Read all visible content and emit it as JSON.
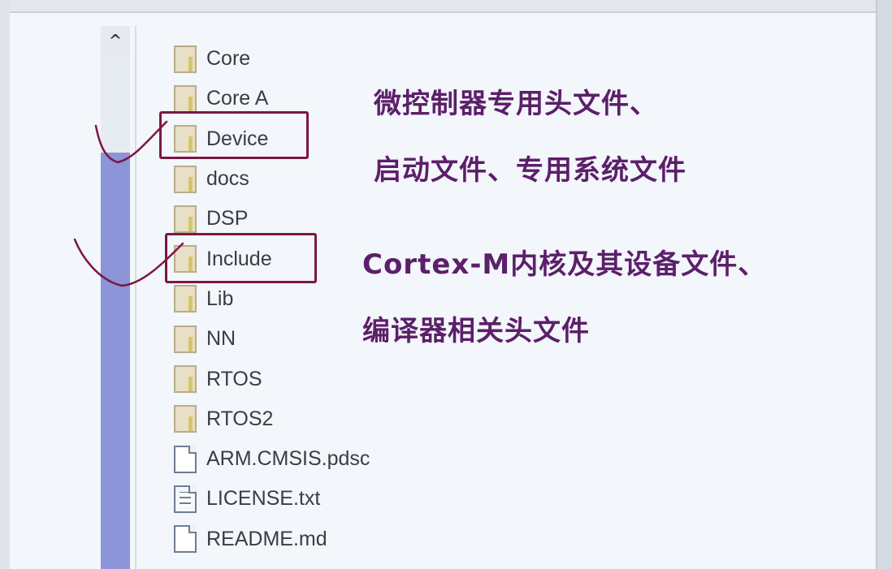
{
  "scrollbar": {
    "up_glyph": "^"
  },
  "files": [
    {
      "name": "Core",
      "type": "folder"
    },
    {
      "name": "Core A",
      "type": "folder"
    },
    {
      "name": "Device",
      "type": "folder",
      "highlighted": true
    },
    {
      "name": "docs",
      "type": "folder"
    },
    {
      "name": "DSP",
      "type": "folder"
    },
    {
      "name": "Include",
      "type": "folder",
      "highlighted": true
    },
    {
      "name": "Lib",
      "type": "folder"
    },
    {
      "name": "NN",
      "type": "folder"
    },
    {
      "name": "RTOS",
      "type": "folder"
    },
    {
      "name": "RTOS2",
      "type": "folder"
    },
    {
      "name": "ARM.CMSIS.pdsc",
      "type": "file"
    },
    {
      "name": "LICENSE.txt",
      "type": "text-file"
    },
    {
      "name": "README.md",
      "type": "file"
    }
  ],
  "annotations": {
    "device_line1": "微控制器专用头文件、",
    "device_line2": "启动文件、专用系统文件",
    "include_line1": "Cortex-M内核及其设备文件、",
    "include_line2": "编译器相关头文件"
  },
  "colors": {
    "annotation_text": "#5c1f6a",
    "highlight_box": "#7c1742",
    "scrollbar_track": "#8c95d8"
  }
}
